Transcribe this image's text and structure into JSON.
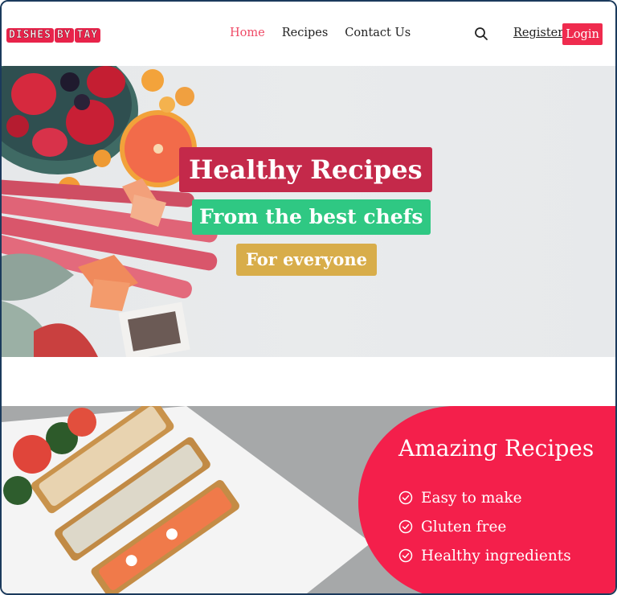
{
  "header": {
    "logo": "DISHES BY TAY",
    "logo_chunks": [
      "DISHES",
      "BY",
      "TAY"
    ],
    "nav": [
      {
        "label": "Home",
        "active": true
      },
      {
        "label": "Recipes",
        "active": false
      },
      {
        "label": "Contact Us",
        "active": false
      }
    ],
    "search_icon": "search-icon",
    "register_label": "Register",
    "login_label": "Login"
  },
  "hero": {
    "title": "Healthy Recipes",
    "subtitle": "From the best chefs",
    "tagline": "For everyone",
    "colors": {
      "title_bg": "#c4294a",
      "subtitle_bg": "#2fc883",
      "tagline_bg": "#d8ad4a"
    }
  },
  "feature": {
    "title": "Amazing Recipes",
    "items": [
      {
        "label": "Easy to make",
        "icon": "check-circle-icon"
      },
      {
        "label": "Gluten free",
        "icon": "check-circle-icon"
      },
      {
        "label": "Healthy ingredients",
        "icon": "check-circle-icon"
      }
    ],
    "accent": "#f41f4b"
  },
  "colors": {
    "brand": "#ef2b4e",
    "nav_active": "#ef4a66"
  }
}
